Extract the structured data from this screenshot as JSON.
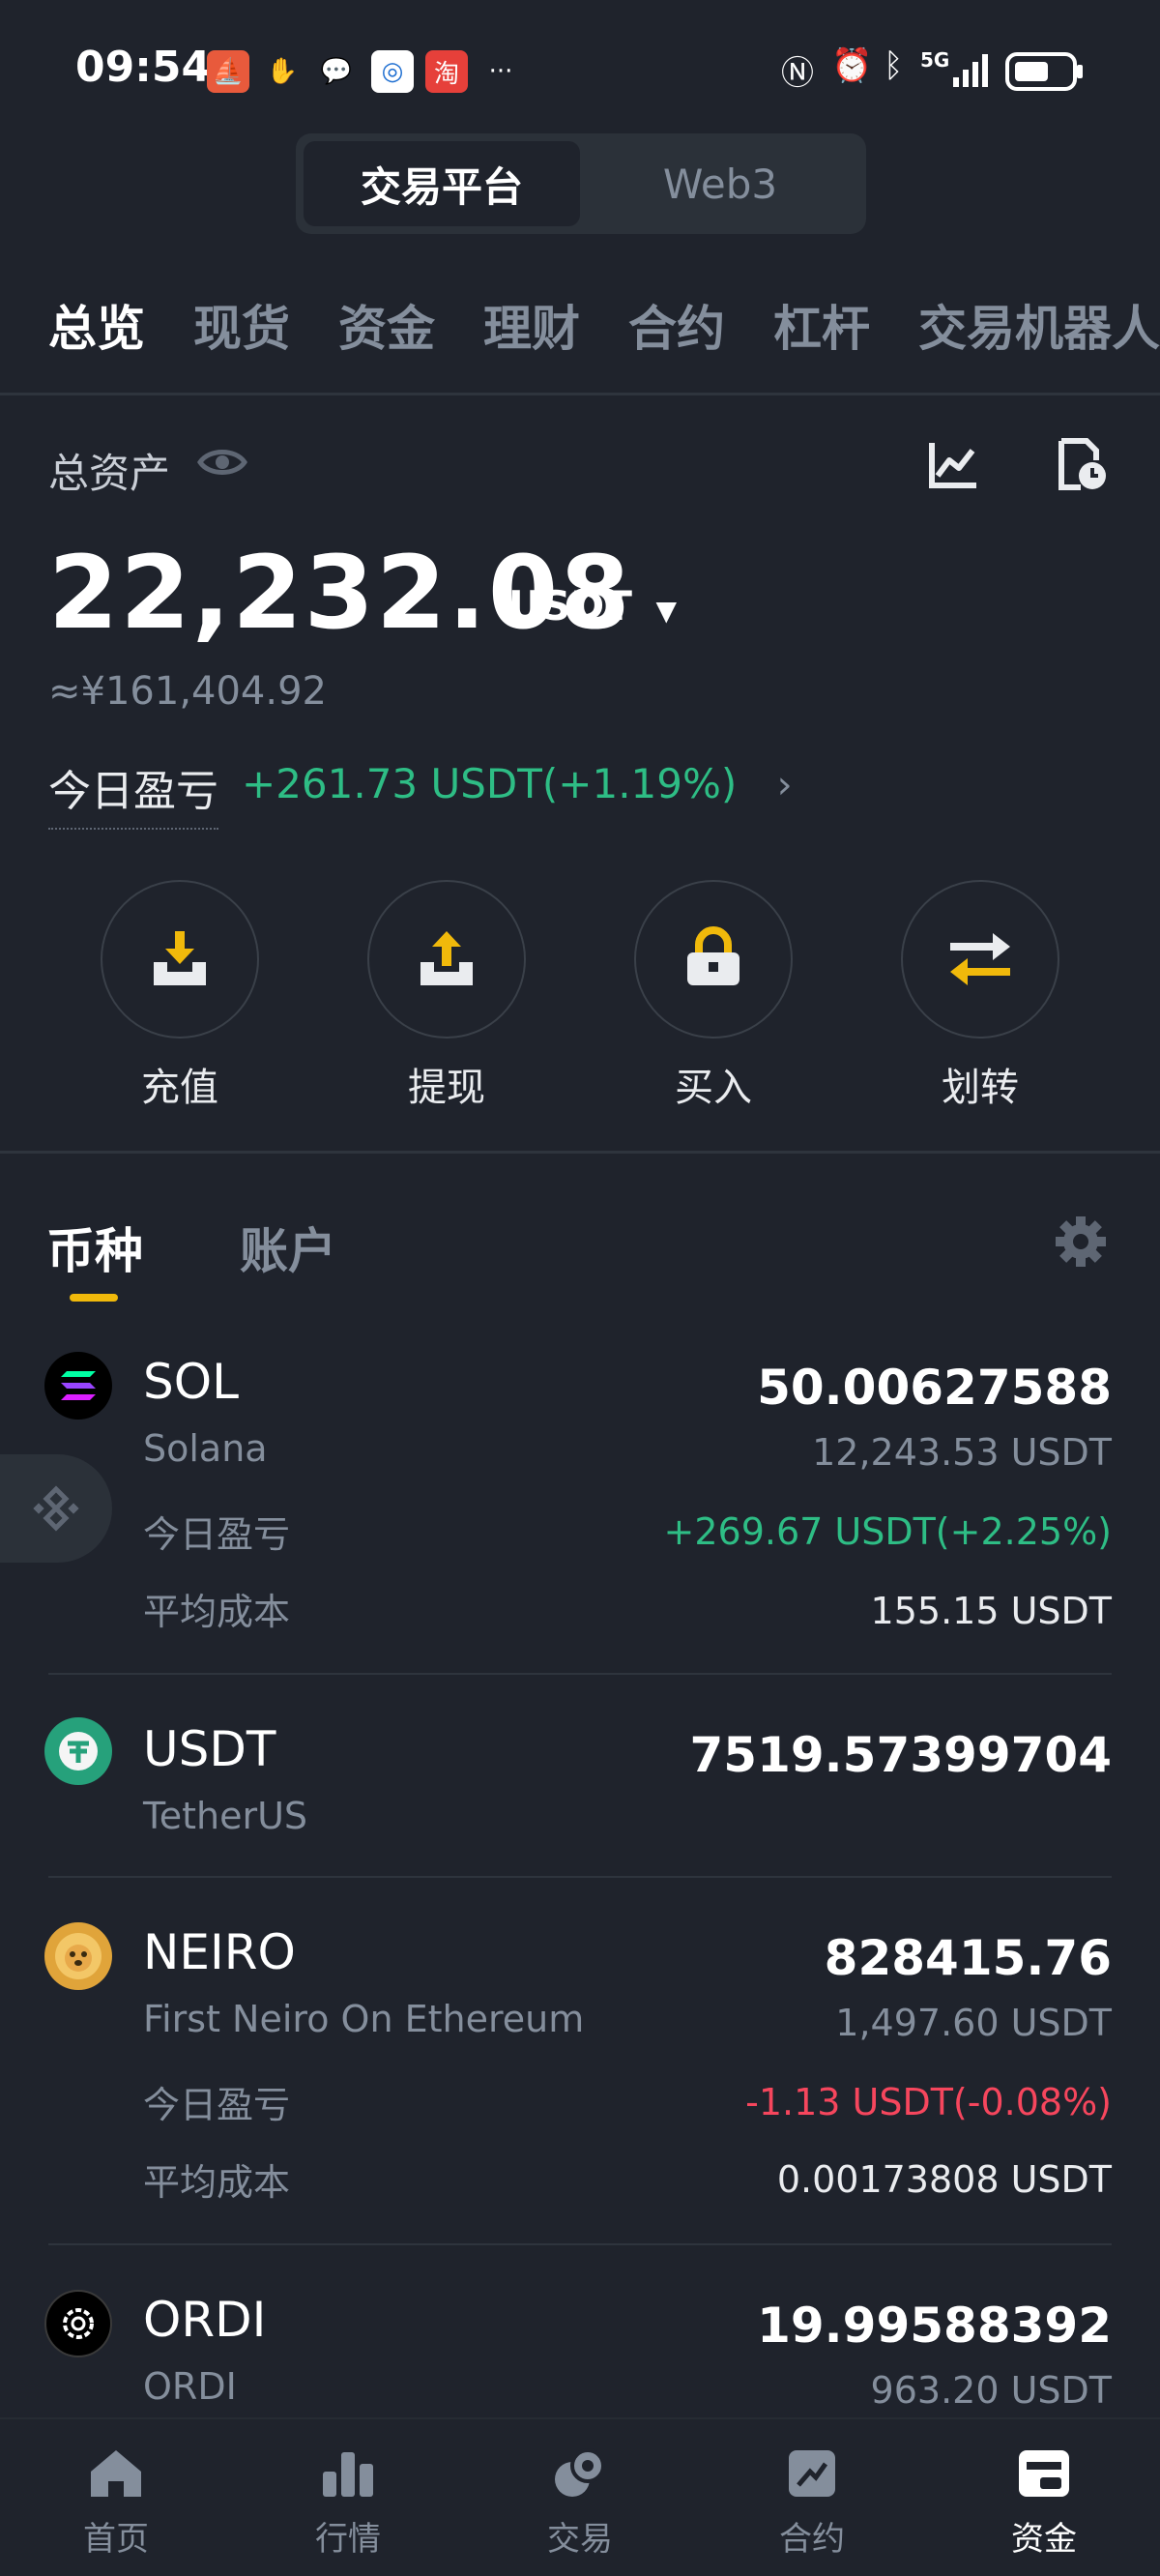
{
  "status_bar": {
    "time": "09:54",
    "network": "5G"
  },
  "segment": {
    "active": "交易平台",
    "other": "Web3"
  },
  "tabs": [
    "总览",
    "现货",
    "资金",
    "理财",
    "合约",
    "杠杆",
    "交易机器人"
  ],
  "assets": {
    "label": "总资产",
    "total": "22,232.08",
    "unit": "USDT",
    "cny": "≈¥161,404.92",
    "pnl_label": "今日盈亏",
    "pnl_value": "+261.73 USDT(+1.19%)"
  },
  "actions": [
    {
      "label": "充值",
      "icon": "deposit-icon"
    },
    {
      "label": "提现",
      "icon": "withdraw-icon"
    },
    {
      "label": "买入",
      "icon": "buy-icon"
    },
    {
      "label": "划转",
      "icon": "transfer-icon"
    }
  ],
  "subtabs": {
    "coin": "币种",
    "account": "账户"
  },
  "coins": [
    {
      "symbol": "SOL",
      "name": "Solana",
      "amount": "50.00627588",
      "usdt": "12,243.53 USDT",
      "pnl_label": "今日盈亏",
      "pnl": "+269.67 USDT(+2.25%)",
      "cost_label": "平均成本",
      "cost": "155.15 USDT"
    },
    {
      "symbol": "USDT",
      "name": "TetherUS",
      "amount": "7519.57399704"
    },
    {
      "symbol": "NEIRO",
      "name": "First Neiro On Ethereum",
      "amount": "828415.76",
      "usdt": "1,497.60 USDT",
      "pnl_label": "今日盈亏",
      "pnl": "-1.13 USDT(-0.08%)",
      "cost_label": "平均成本",
      "cost": "0.00173808 USDT"
    },
    {
      "symbol": "ORDI",
      "name": "ORDI",
      "amount": "19.99588392",
      "usdt": "963.20 USDT"
    }
  ],
  "bottom_nav": [
    {
      "label": "首页",
      "icon": "home-icon"
    },
    {
      "label": "行情",
      "icon": "markets-icon"
    },
    {
      "label": "交易",
      "icon": "trade-icon"
    },
    {
      "label": "合约",
      "icon": "futures-icon"
    },
    {
      "label": "资金",
      "icon": "wallet-icon"
    }
  ],
  "colors": {
    "background": "#1f232c",
    "accent": "#f0b90b",
    "positive": "#2ebd85",
    "negative": "#f6465d"
  }
}
